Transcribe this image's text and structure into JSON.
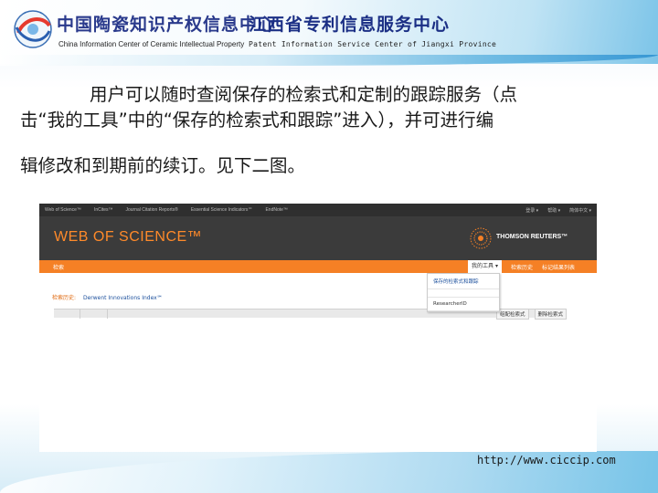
{
  "header": {
    "org1_cn": "中国陶瓷知识产权信息中心",
    "org1_en": "China Information Center of Ceramic Intellectual Property",
    "org2_cn": "江西省专利信息服务中心",
    "org2_en": "Patent Information Service Center of Jiangxi Province",
    "logo_icon": "globe-swirl-logo-icon"
  },
  "paragraph": {
    "line1": "用户可以随时查阅保存的检索式和定制的跟踪服务（点",
    "line2": "击“我的工具”中的“保存的检索式和跟踪”进入），并可进行编",
    "line3": "辑修改和到期前的续订。见下二图。"
  },
  "screenshot": {
    "topnav": {
      "items": [
        "Web of Science™",
        "InCites™",
        "Journal Citation Reports®",
        "Essential Science Indicators℠",
        "EndNote™"
      ],
      "right": [
        "登录 ▾",
        "帮助 ▾",
        "简体中文 ▾"
      ]
    },
    "banner": {
      "title": "WEB OF SCIENCE™",
      "brand": "THOMSON REUTERS™",
      "colors": {
        "banner_bg": "#3b3b3b",
        "title": "#ff8a2a",
        "orange_bar": "#f58025"
      }
    },
    "orange_bar": {
      "search": "检索",
      "my_tools": "我的工具 ▾",
      "history": "检索历史",
      "marked": "标记结果列表"
    },
    "dropdown": {
      "item1": "保存的检索式和跟踪",
      "item2": "ResearcherID"
    },
    "subnav": {
      "history": "检索历史:",
      "db": "Derwent Innovations Index℠"
    },
    "combine": {
      "combine_label": "组配检索式",
      "delete_label": "删除检索式"
    }
  },
  "footer": {
    "url": "http://www.ciccip.com"
  }
}
